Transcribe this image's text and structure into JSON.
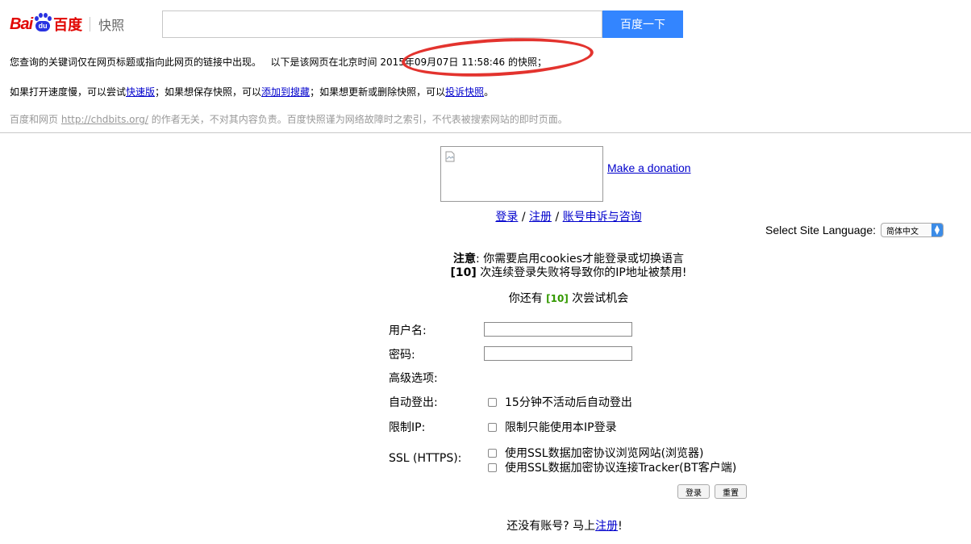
{
  "baidu": {
    "logo_bai": "Bai",
    "logo_du": "du",
    "logo_baidu": "百度",
    "logo_kuaizhao": "快照",
    "search_value": "",
    "search_button": "百度一下",
    "line1_prefix": "您查询的关键词仅在网页标题或指向此网页的链接中出现。",
    "line1_mid": "以下是该网页在北京时间",
    "line1_time": "2015年09月07日 11:58:46",
    "line1_suffix": "的快照；",
    "line2_a": "如果打开速度慢，可以尝试",
    "line2_link1": "快速版",
    "line2_b": "；如果想保存快照，可以",
    "line2_link2": "添加到搜藏",
    "line2_c": "；如果想更新或删除快照，可以",
    "line2_link3": "投诉快照",
    "line2_d": "。",
    "line3_a": "百度和网页",
    "line3_link": "http://chdbits.org/",
    "line3_b": "的作者无关，不对其内容负责。百度快照谨为网络故障时之索引，不代表被搜索网站的即时页面。",
    "highlight_color": "#e3332e"
  },
  "site": {
    "donate_link": "Make a donation",
    "nav": {
      "login": "登录",
      "sep": " / ",
      "register": "注册",
      "appeal": "账号申诉与咨询"
    },
    "language_label": "Select Site Language:",
    "language_value": "简体中文",
    "notice_label": "注意",
    "notice_text": ": 你需要启用cookies才能登录或切换语言",
    "warning_count": "[10]",
    "warning_text": " 次连续登录失败将导致你的IP地址被禁用!",
    "attempts_prefix": "你还有 ",
    "attempts_count": "[10]",
    "attempts_suffix": " 次尝试机会",
    "form": {
      "username_label": "用户名:",
      "username_value": "",
      "password_label": "密码:",
      "password_value": "",
      "advanced_label": "高级选项:",
      "autologout_label": "自动登出:",
      "autologout_option": "15分钟不活动后自动登出",
      "restrict_ip_label": "限制IP:",
      "restrict_ip_option": "限制只能使用本IP登录",
      "ssl_label": "SSL (HTTPS):",
      "ssl_option1": "使用SSL数据加密协议浏览网站(浏览器)",
      "ssl_option2": "使用SSL数据加密协议连接Tracker(BT客户端)",
      "login_button": "登录",
      "reset_button": "重置"
    },
    "signup_prefix": "还没有账号? 马上",
    "signup_link": "注册",
    "signup_suffix": "!"
  }
}
